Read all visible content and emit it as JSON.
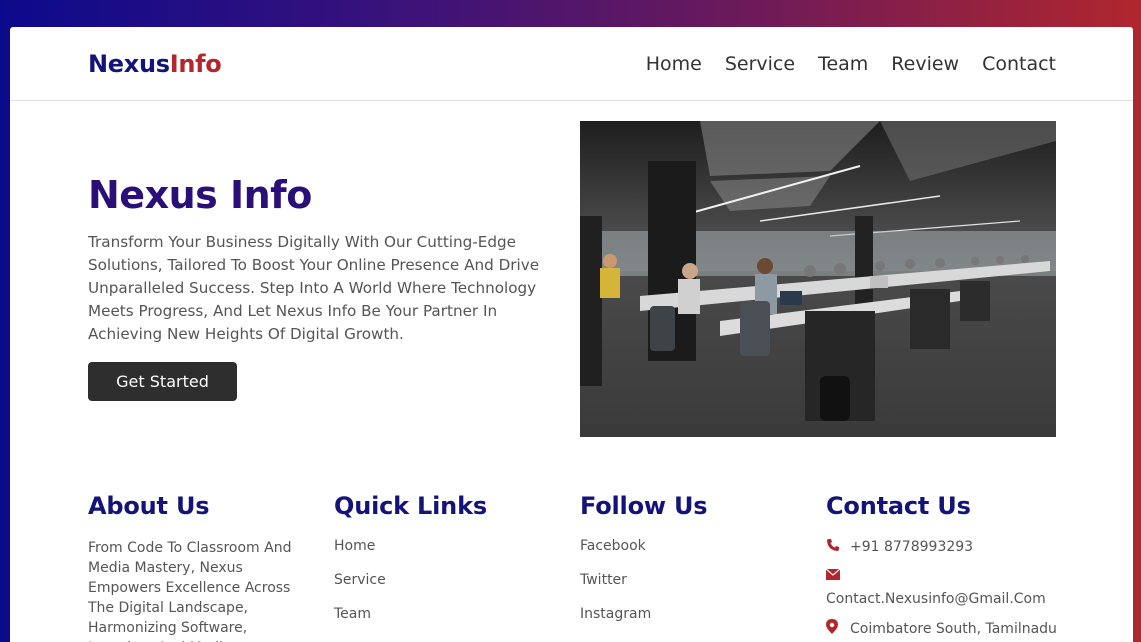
{
  "brand": {
    "part1": "Nexus",
    "part2": "Info"
  },
  "nav": {
    "items": [
      "Home",
      "Service",
      "Team",
      "Review",
      "Contact"
    ]
  },
  "hero": {
    "title": "Nexus Info",
    "description": "Transform Your Business Digitally With Our Cutting-Edge Solutions, Tailored To Boost Your Online Presence And Drive Unparalleled Success. Step Into A World Where Technology Meets Progress, And Let Nexus Info Be Your Partner In Achieving New Heights Of Digital Growth.",
    "cta": "Get Started"
  },
  "footer": {
    "about": {
      "title": "About Us",
      "text": "From Code To Classroom And Media Mastery, Nexus Empowers Excellence Across The Digital Landscape, Harmonizing Software, Learning, And Media"
    },
    "quick_links": {
      "title": "Quick Links",
      "items": [
        "Home",
        "Service",
        "Team"
      ]
    },
    "follow": {
      "title": "Follow Us",
      "items": [
        "Facebook",
        "Twitter",
        "Instagram"
      ]
    },
    "contact": {
      "title": "Contact Us",
      "phone": "+91 8778993293",
      "email": "Contact.Nexusinfo@Gmail.Com",
      "location": "Coimbatore South, Tamilnadu"
    }
  },
  "colors": {
    "brand_blue": "#13137a",
    "brand_red": "#b3262c",
    "button_bg": "#2e2e2e"
  },
  "icons": {
    "phone": "phone-icon",
    "email": "envelope-icon",
    "location": "map-pin-icon"
  }
}
